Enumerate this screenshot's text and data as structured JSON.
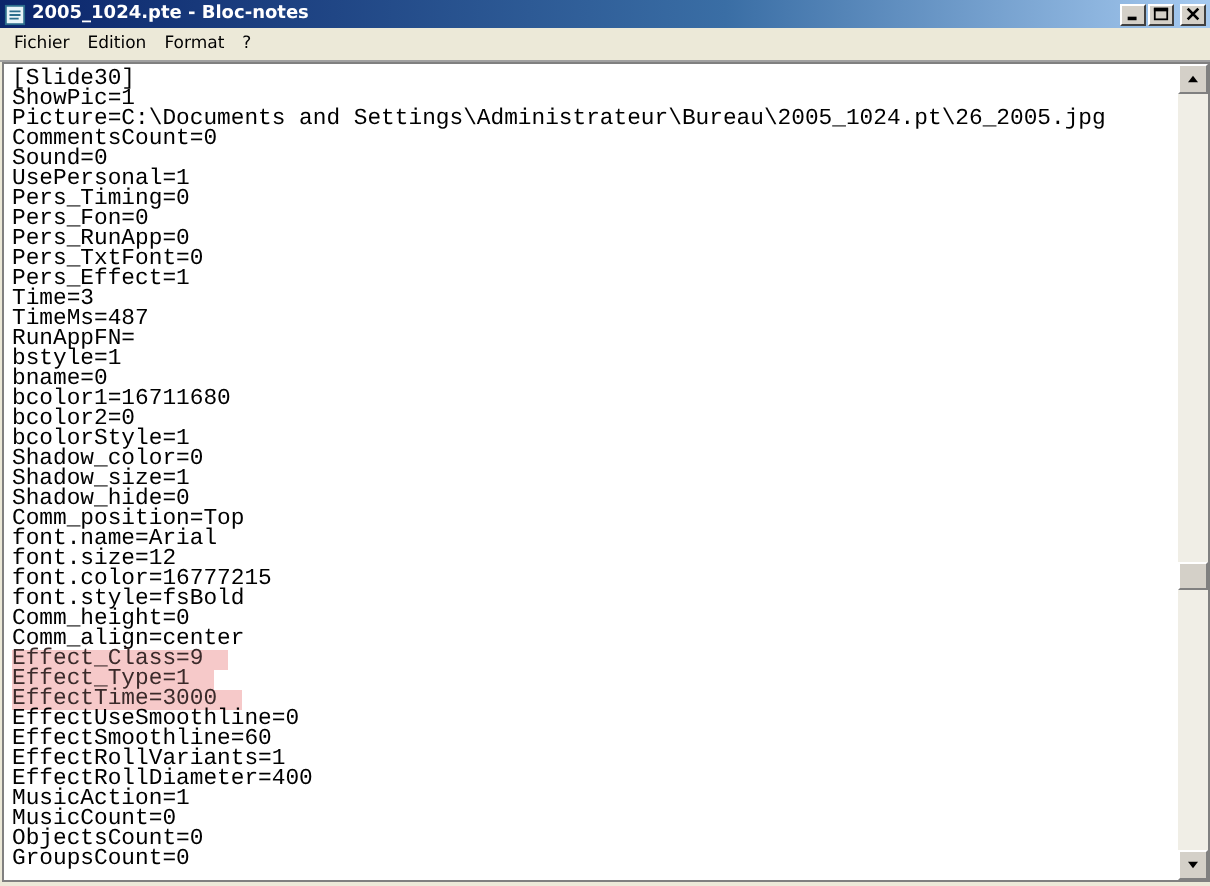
{
  "window": {
    "title": "2005_1024.pte - Bloc-notes"
  },
  "menu": [
    "Fichier",
    "Edition",
    "Format",
    "?"
  ],
  "lines": [
    {
      "text": "[Slide30]",
      "highlighted": false
    },
    {
      "text": "ShowPic=1",
      "highlighted": false
    },
    {
      "text": "Picture=C:\\Documents and Settings\\Administrateur\\Bureau\\2005_1024.pt\\26_2005.jpg",
      "highlighted": false
    },
    {
      "text": "CommentsCount=0",
      "highlighted": false
    },
    {
      "text": "Sound=0",
      "highlighted": false
    },
    {
      "text": "UsePersonal=1",
      "highlighted": false
    },
    {
      "text": "Pers_Timing=0",
      "highlighted": false
    },
    {
      "text": "Pers_Fon=0",
      "highlighted": false
    },
    {
      "text": "Pers_RunApp=0",
      "highlighted": false
    },
    {
      "text": "Pers_TxtFont=0",
      "highlighted": false
    },
    {
      "text": "Pers_Effect=1",
      "highlighted": false
    },
    {
      "text": "Time=3",
      "highlighted": false
    },
    {
      "text": "TimeMs=487",
      "highlighted": false
    },
    {
      "text": "RunAppFN=",
      "highlighted": false
    },
    {
      "text": "bstyle=1",
      "highlighted": false
    },
    {
      "text": "bname=0",
      "highlighted": false
    },
    {
      "text": "bcolor1=16711680",
      "highlighted": false
    },
    {
      "text": "bcolor2=0",
      "highlighted": false
    },
    {
      "text": "bcolorStyle=1",
      "highlighted": false
    },
    {
      "text": "Shadow_color=0",
      "highlighted": false
    },
    {
      "text": "Shadow_size=1",
      "highlighted": false
    },
    {
      "text": "Shadow_hide=0",
      "highlighted": false
    },
    {
      "text": "Comm_position=Top",
      "highlighted": false
    },
    {
      "text": "font.name=Arial",
      "highlighted": false
    },
    {
      "text": "font.size=12",
      "highlighted": false
    },
    {
      "text": "font.color=16777215",
      "highlighted": false
    },
    {
      "text": "font.style=fsBold",
      "highlighted": false
    },
    {
      "text": "Comm_height=0",
      "highlighted": false
    },
    {
      "text": "Comm_align=center",
      "highlighted": false
    },
    {
      "text": "Effect_Class=9",
      "highlighted": true
    },
    {
      "text": "Effect_Type=1",
      "highlighted": true
    },
    {
      "text": "EffectTime=3000",
      "highlighted": true
    },
    {
      "text": "EffectUseSmoothline=0",
      "highlighted": false
    },
    {
      "text": "EffectSmoothline=60",
      "highlighted": false
    },
    {
      "text": "EffectRollVariants=1",
      "highlighted": false
    },
    {
      "text": "EffectRollDiameter=400",
      "highlighted": false
    },
    {
      "text": "MusicAction=1",
      "highlighted": false
    },
    {
      "text": "MusicCount=0",
      "highlighted": false
    },
    {
      "text": "ObjectsCount=0",
      "highlighted": false
    },
    {
      "text": "GroupsCount=0",
      "highlighted": false
    }
  ]
}
